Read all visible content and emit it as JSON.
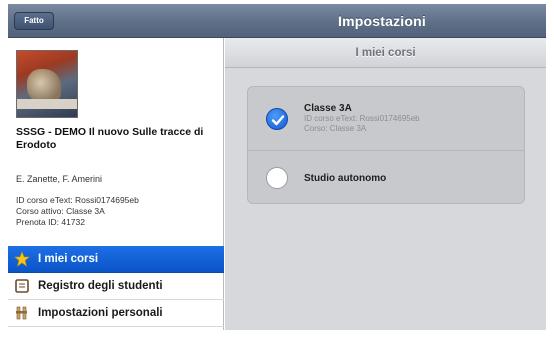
{
  "topbar": {
    "done_label": "Fatto",
    "title": "Impostazioni"
  },
  "sidebar": {
    "book_title": "SSSG - DEMO Il nuovo Sulle tracce di Erodoto",
    "authors": "E. Zanette, F. Amerini",
    "etext_id": "ID corso eText: Rossi0174695eb",
    "active_course": "Corso attivo: Classe 3A",
    "prenota_id": "Prenota ID: 41732",
    "menu": [
      {
        "label": "I miei corsi",
        "icon": "star-icon",
        "active": true
      },
      {
        "label": "Registro degli studenti",
        "icon": "register-icon",
        "active": false
      },
      {
        "label": "Impostazioni personali",
        "icon": "settings-icon",
        "active": false
      }
    ]
  },
  "main": {
    "header": "I miei corsi",
    "courses": [
      {
        "name": "Classe 3A",
        "id_line": "ID corso eText: Rossi0174695eb",
        "course_line": "Corso: Classe 3A",
        "selected": true
      },
      {
        "name": "Studio autonomo",
        "selected": false
      }
    ]
  },
  "colors": {
    "accent": "#0f5fd6",
    "topbar": "#5e6f88",
    "panel": "#d6d8dc"
  }
}
